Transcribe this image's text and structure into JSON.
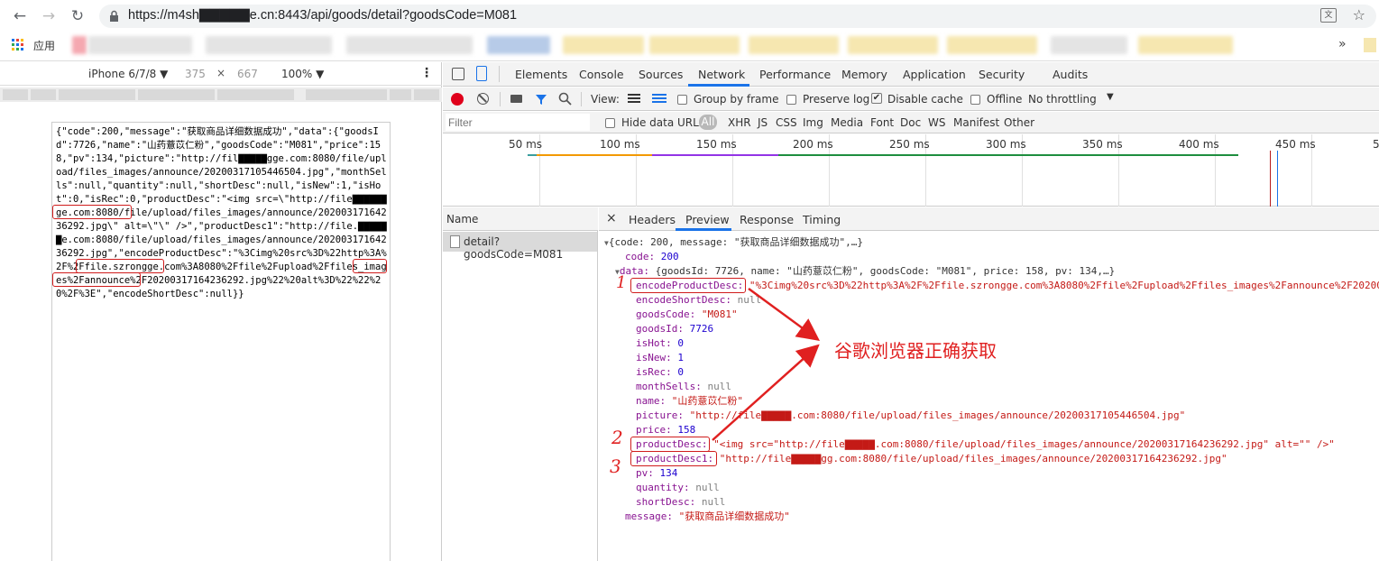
{
  "browser": {
    "url": "https://m4sh▇▇▇▇▇e.cn:8443/api/goods/detail?goodsCode=M081",
    "apps_label": "应用",
    "more_bookmarks": "»"
  },
  "device_toolbar": {
    "device": "iPhone 6/7/8 ▼",
    "width": "375",
    "times": "×",
    "height": "667",
    "zoom": "100% ▼",
    "menu": "⋮"
  },
  "raw_json_text": "{\"code\":200,\"message\":\"获取商品详细数据成功\",\"data\":{\"goodsId\":7726,\"name\":\"山药薏苡仁粉\",\"goodsCode\":\"M081\",\"price\":158,\"pv\":134,\"picture\":\"http://fil▇▇▇▇▇gge.com:8080/file/upload/files_images/announce/20200317105446504.jpg\",\"monthSells\":null,\"quantity\":null,\"shortDesc\":null,\"isNew\":1,\"isHot\":0,\"isRec\":0,\"productDesc\":\"<img src=\\\"http://file▇▇▇▇▇▇ge.com:8080/file/upload/files_images/announce/20200317164236292.jpg\\\" alt=\\\"\\\" />\",\"productDesc1\":\"http://file.▇▇▇▇▇▇e.com:8080/file/upload/files_images/announce/20200317164236292.jpg\",\"encodeProductDesc\":\"%3Cimg%20src%3D%22http%3A%2F%2Ffile.szrongge.com%3A8080%2Ffile%2Fupload%2Ffiles_images%2Fannounce%2F20200317164236292.jpg%22%20alt%3D%22%22%20%2F%3E\",\"encodeShortDesc\":null}}",
  "devtools": {
    "tabs": [
      "Elements",
      "Console",
      "Sources",
      "Network",
      "Performance",
      "Memory",
      "Application",
      "Security",
      "Audits"
    ],
    "active_tab": "Network",
    "toolbar": {
      "view_label": "View:",
      "group_by_frame": "Group by frame",
      "preserve_log": "Preserve log",
      "disable_cache": "Disable cache",
      "offline": "Offline",
      "throttling": "No throttling"
    },
    "filter": {
      "placeholder": "Filter",
      "hide_data_urls": "Hide data URLs",
      "types": [
        "All",
        "XHR",
        "JS",
        "CSS",
        "Img",
        "Media",
        "Font",
        "Doc",
        "WS",
        "Manifest",
        "Other"
      ]
    },
    "timeline_ticks": [
      "50 ms",
      "100 ms",
      "150 ms",
      "200 ms",
      "250 ms",
      "300 ms",
      "350 ms",
      "400 ms",
      "450 ms",
      "5"
    ],
    "name_header": "Name",
    "request_name": "detail?goodsCode=M081",
    "detail_tabs": [
      "Headers",
      "Preview",
      "Response",
      "Timing"
    ],
    "close": "×"
  },
  "preview": {
    "root": "{code: 200, message: \"获取商品详细数据成功\",…}",
    "code": {
      "key": "code:",
      "val": "200"
    },
    "data_summary": {
      "key": "data:",
      "val": "{goodsId: 7726, name: \"山药薏苡仁粉\", goodsCode: \"M081\", price: 158, pv: 134,…}"
    },
    "fields": [
      {
        "key": "encodeProductDesc:",
        "val": "\"%3Cimg%20src%3D%22http%3A%2F%2Ffile.szrongge.com%3A8080%2Ffile%2Fupload%2Ffiles_images%2Fannounce%2F20200",
        "type": "s"
      },
      {
        "key": "encodeShortDesc:",
        "val": "null",
        "type": "g"
      },
      {
        "key": "goodsCode:",
        "val": "\"M081\"",
        "type": "s"
      },
      {
        "key": "goodsId:",
        "val": "7726",
        "type": "n"
      },
      {
        "key": "isHot:",
        "val": "0",
        "type": "n"
      },
      {
        "key": "isNew:",
        "val": "1",
        "type": "n"
      },
      {
        "key": "isRec:",
        "val": "0",
        "type": "n"
      },
      {
        "key": "monthSells:",
        "val": "null",
        "type": "g"
      },
      {
        "key": "name:",
        "val": "\"山药薏苡仁粉\"",
        "type": "s"
      },
      {
        "key": "picture:",
        "val": "\"http://file▇▇▇▇▇.com:8080/file/upload/files_images/announce/20200317105446504.jpg\"",
        "type": "s"
      },
      {
        "key": "price:",
        "val": "158",
        "type": "n"
      },
      {
        "key": "productDesc:",
        "val": "\"<img src=\"http://file▇▇▇▇▇.com:8080/file/upload/files_images/announce/20200317164236292.jpg\" alt=\"\" />\"",
        "type": "s"
      },
      {
        "key": "productDesc1:",
        "val": "\"http://file▇▇▇▇▇gg.com:8080/file/upload/files_images/announce/20200317164236292.jpg\"",
        "type": "s"
      },
      {
        "key": "pv:",
        "val": "134",
        "type": "n"
      },
      {
        "key": "quantity:",
        "val": "null",
        "type": "g"
      },
      {
        "key": "shortDesc:",
        "val": "null",
        "type": "g"
      }
    ],
    "message": {
      "key": "message:",
      "val": "\"获取商品详细数据成功\""
    }
  },
  "annotations": {
    "callout": "谷歌浏览器正确获取",
    "num1": "1",
    "num2": "2",
    "num3": "3",
    "color": "#e02020"
  }
}
